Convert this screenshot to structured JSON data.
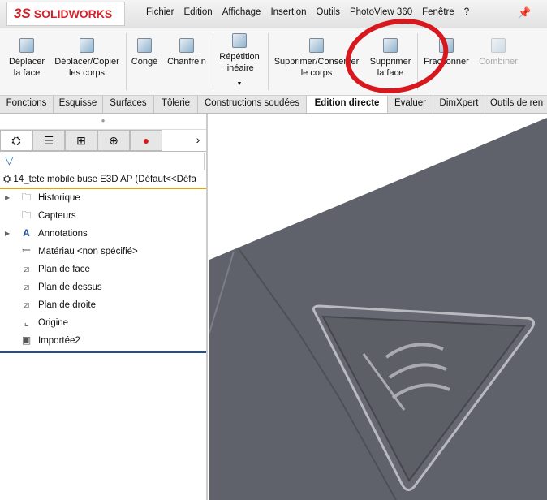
{
  "app": {
    "logo": "SOLIDWORKS",
    "logo_prefix": "3S"
  },
  "menu": [
    "Fichier",
    "Edition",
    "Affichage",
    "Insertion",
    "Outils",
    "PhotoView 360",
    "Fenêtre",
    "?"
  ],
  "ribbon": [
    {
      "l1": "Déplacer",
      "l2": "la face"
    },
    {
      "l1": "Déplacer/Copier",
      "l2": "les corps"
    },
    {
      "l1": "Congé",
      "l2": ""
    },
    {
      "l1": "Chanfrein",
      "l2": ""
    },
    {
      "l1": "Répétition",
      "l2": "linéaire"
    },
    {
      "l1": "Supprimer/Conserver",
      "l2": "le corps"
    },
    {
      "l1": "Supprimer",
      "l2": "la face"
    },
    {
      "l1": "Fractionner",
      "l2": ""
    },
    {
      "l1": "Combiner",
      "l2": ""
    }
  ],
  "tabs": [
    "Fonctions",
    "Esquisse",
    "Surfaces",
    "Tôlerie",
    "Constructions soudées",
    "Edition directe",
    "Evaluer",
    "DimXpert",
    "Outils de ren"
  ],
  "tree": {
    "root": "14_tete mobile buse E3D AP  (Défaut<<Défa",
    "items": [
      "Historique",
      "Capteurs",
      "Annotations",
      "Matériau <non spécifié>",
      "Plan de face",
      "Plan de dessus",
      "Plan de droite",
      "Origine",
      "Importée2"
    ]
  },
  "colors": {
    "accent": "#d7191f",
    "model": "#5f626a"
  }
}
